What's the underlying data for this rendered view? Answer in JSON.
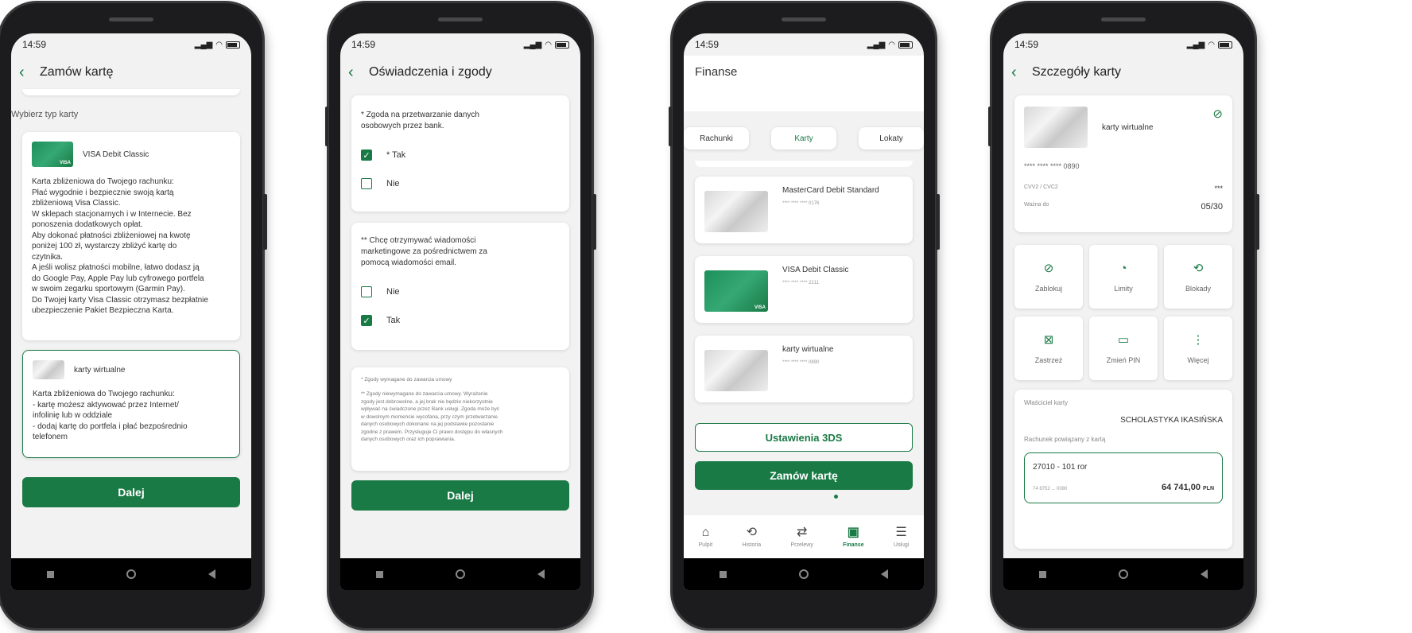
{
  "status": {
    "time": "14:59"
  },
  "screen1": {
    "title": "Zamów kartę",
    "section_label": "Wybierz typ karty",
    "visa_card": {
      "name": "VISA Debit Classic",
      "lines": [
        "Karta zbliżeniowa do Twojego rachunku:",
        "Płać wygodnie i bezpiecznie swoją kartą",
        "zbliżeniową Visa Classic.",
        "W sklepach stacjonarnych i w Internecie. Bez",
        "ponoszenia dodatkowych opłat.",
        "Aby dokonać płatności zbliżeniowej na kwotę",
        "poniżej 100 zł, wystarczy zbliżyć kartę do",
        "czytnika.",
        "A jeśli wolisz płatności mobilne, łatwo dodasz ją",
        "do Google Pay, Apple Pay lub cyfrowego portfela",
        "w swoim zegarku sportowym (Garmin Pay).",
        "Do Twojej karty Visa Classic otrzymasz bezpłatnie",
        "ubezpieczenie Pakiet Bezpieczna Karta."
      ]
    },
    "virtual_card": {
      "name": "karty wirtualne",
      "lines": [
        "Karta zbliżeniowa do Twojego rachunku:",
        "- kartę możesz aktywować przez Internet/",
        "infolinię lub w oddziale",
        "- dodaj kartę do portfela i płać bezpośrednio",
        "telefonem"
      ]
    },
    "next_label": "Dalej"
  },
  "screen2": {
    "title": "Oświadczenia i zgody",
    "consent1": {
      "text_l1": "* Zgoda na przetwarzanie danych",
      "text_l2": "osobowych przez bank.",
      "opt_yes": "* Tak",
      "opt_no": "Nie",
      "checked": "yes"
    },
    "consent2": {
      "text_l1": "** Chcę otrzymywać wiadomości",
      "text_l2": "marketingowe za pośrednictwem za",
      "text_l3": "pomocą wiadomości email.",
      "opt_no": "Nie",
      "opt_yes": "Tak",
      "checked": "yes"
    },
    "footnote1": "* Zgody wymagane do zawarcia umowy",
    "footnote2": [
      "** Zgody niewymagane do zawarcia umowy. Wyrażenie",
      "zgody jest dobrowolne, a jej brak nie będzie niekorzystnie",
      "wpływać na świadczone przez Bank usługi. Zgoda może być",
      "w dowolnym momencie wycofana, przy czym przetwarzanie",
      "danych osobowych dokonane na jej podstawie pozostanie",
      "zgodne z prawem. Przysługuje Ci prawo dostępu do własnych",
      "danych osobowych oraz ich poprawiania."
    ],
    "next_label": "Dalej"
  },
  "screen3": {
    "title": "Finanse",
    "tabs": [
      "Rachunki",
      "Karty",
      "Lokaty"
    ],
    "cards": [
      {
        "name": "MasterCard Debit Standard",
        "number": "**** **** **** 0176",
        "style": "grey"
      },
      {
        "name": "VISA Debit Classic",
        "number": "**** **** **** 2211",
        "style": "visa"
      },
      {
        "name": "karty wirtualne",
        "number": "**** **** **** 0890",
        "style": "grey"
      }
    ],
    "btn_3ds": "Ustawienia 3DS",
    "btn_order": "Zamów kartę",
    "bottom_tabs": [
      {
        "label": "Pulpit",
        "icon": "home-icon",
        "glyph": "⌂"
      },
      {
        "label": "Historia",
        "icon": "history-icon",
        "glyph": "⟲"
      },
      {
        "label": "Przelewy",
        "icon": "transfer-icon",
        "glyph": "⇄"
      },
      {
        "label": "Finanse",
        "icon": "finance-icon",
        "glyph": "▣"
      },
      {
        "label": "Usługi",
        "icon": "services-icon",
        "glyph": "☰"
      }
    ]
  },
  "screen4": {
    "title": "Szczegóły karty",
    "card_name": "karty wirtualne",
    "card_number": "**** **** **** 0890",
    "cvv_label": "CVV2 / CVC2",
    "cvv_value": "***",
    "valid_label": "Ważna do",
    "valid_value": "05/30",
    "actions": [
      {
        "label": "Zablokuj",
        "icon": "block-icon",
        "glyph": "⊘"
      },
      {
        "label": "Limity",
        "icon": "gauge-icon",
        "glyph": "◔"
      },
      {
        "label": "Blokady",
        "icon": "history-icon",
        "glyph": "⟲"
      },
      {
        "label": "Zastrzeż",
        "icon": "card-cancel-icon",
        "glyph": "⊠"
      },
      {
        "label": "Zmień PIN",
        "icon": "pin-icon",
        "glyph": "▭"
      },
      {
        "label": "Więcej",
        "icon": "more-icon",
        "glyph": "⋮"
      }
    ],
    "owner_label": "Właściciel karty",
    "owner_name": "SCHOLASTYKA IKASIŃSKA",
    "account_label": "Rachunek powiązany z kartą",
    "account_name": "27010 - 101 ror",
    "account_number": "74 8752 ... 0080",
    "account_balance": "64 741,00",
    "account_currency": "PLN"
  }
}
